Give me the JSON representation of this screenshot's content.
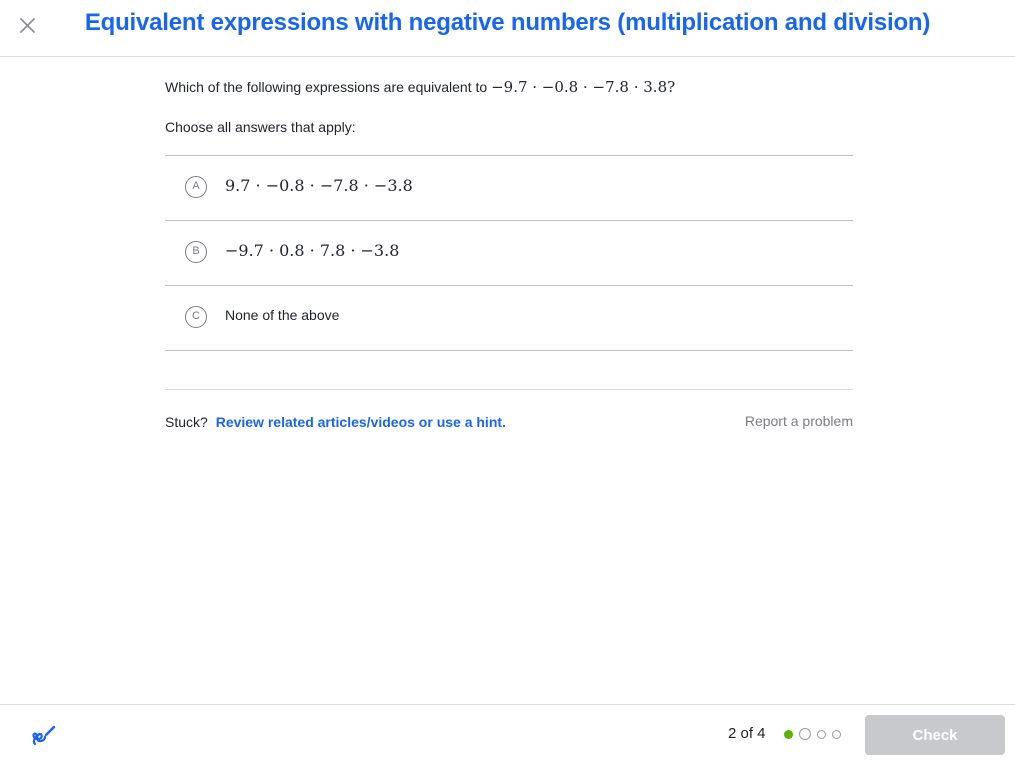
{
  "header": {
    "title": "Equivalent expressions with negative numbers (multiplication and division)",
    "close_icon": "close-icon"
  },
  "question": {
    "text": "Which of the following expressions are equivalent to",
    "expression": "−9.7 · −0.8 · −7.8 · 3.8",
    "end": "?",
    "prompt": "Choose all answers that apply:"
  },
  "choices": [
    {
      "letter": "A",
      "text": "9.7 · −0.8 · −7.8 · −3.8",
      "is_math": true
    },
    {
      "letter": "B",
      "text": "−9.7 · 0.8 · 7.8 · −3.8",
      "is_math": true
    },
    {
      "letter": "C",
      "text": "None of the above",
      "is_math": false
    }
  ],
  "help": {
    "stuck_label": "Stuck?",
    "hint_link": "Review related articles/videos or use a hint.",
    "report_link": "Report a problem"
  },
  "footer": {
    "scratchpad_icon": "pencil-scratchpad-icon",
    "progress_text": "2 of 4",
    "progress": {
      "current": 2,
      "total": 4,
      "completed": 1
    },
    "check_label": "Check"
  },
  "colors": {
    "accent": "#1865f2",
    "done_dot": "#5cb300",
    "check_disabled": "#c8c9cc"
  }
}
